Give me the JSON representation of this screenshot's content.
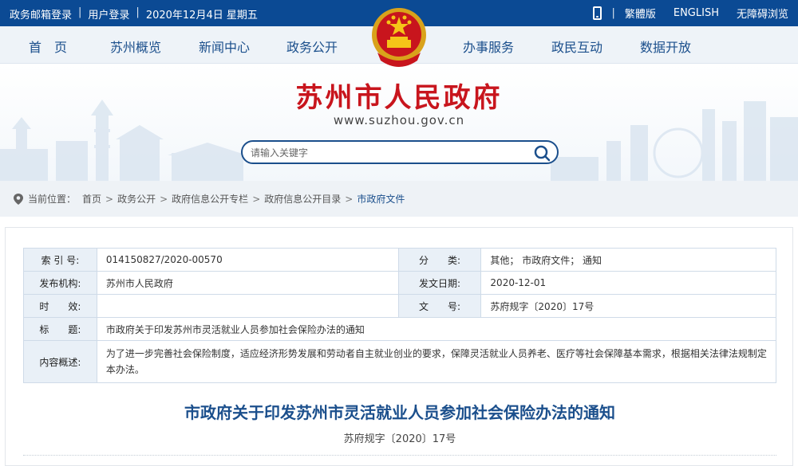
{
  "topbar": {
    "left": [
      "政务邮箱登录",
      "用户登录",
      "2020年12月4日 星期五"
    ],
    "right": [
      "繁體版",
      "ENGLISH",
      "无障碍浏览"
    ]
  },
  "nav": {
    "left_items": [
      "首　页",
      "苏州概览",
      "新闻中心",
      "政务公开"
    ],
    "right_items": [
      "办事服务",
      "政民互动",
      "数据开放"
    ]
  },
  "header": {
    "title": "苏州市人民政府",
    "url": "www.suzhou.gov.cn"
  },
  "search": {
    "placeholder": "请输入关键字"
  },
  "breadcrumb": {
    "label": "当前位置：",
    "items": [
      "首页",
      "政务公开",
      "政府信息公开专栏",
      "政府信息公开目录",
      "市政府文件"
    ]
  },
  "info": {
    "index_label": "索 引 号:",
    "index_value": "014150827/2020-00570",
    "category_label": "分　　类:",
    "category_value": "其他； 市政府文件； 通知",
    "publisher_label": "发布机构:",
    "publisher_value": "苏州市人民政府",
    "date_label": "发文日期:",
    "date_value": "2020-12-01",
    "validity_label": "时　　效:",
    "validity_value": "",
    "docno_label": "文　　号:",
    "docno_value": "苏府规字〔2020〕17号",
    "subject_label": "标　　题:",
    "subject_value": "市政府关于印发苏州市灵活就业人员参加社会保险办法的通知",
    "summary_label": "内容概述:",
    "summary_value": "为了进一步完善社会保险制度，适应经济形势发展和劳动者自主就业创业的要求，保障灵活就业人员养老、医疗等社会保障基本需求，根据相关法律法规制定本办法。"
  },
  "document": {
    "title": "市政府关于印发苏州市灵活就业人员参加社会保险办法的通知",
    "number": "苏府规字〔2020〕17号"
  },
  "colors": {
    "topbar": "#0b4a94",
    "nav_text": "#1b4f8c",
    "title_red": "#c8151d",
    "label_bg": "#e9f0f7"
  }
}
